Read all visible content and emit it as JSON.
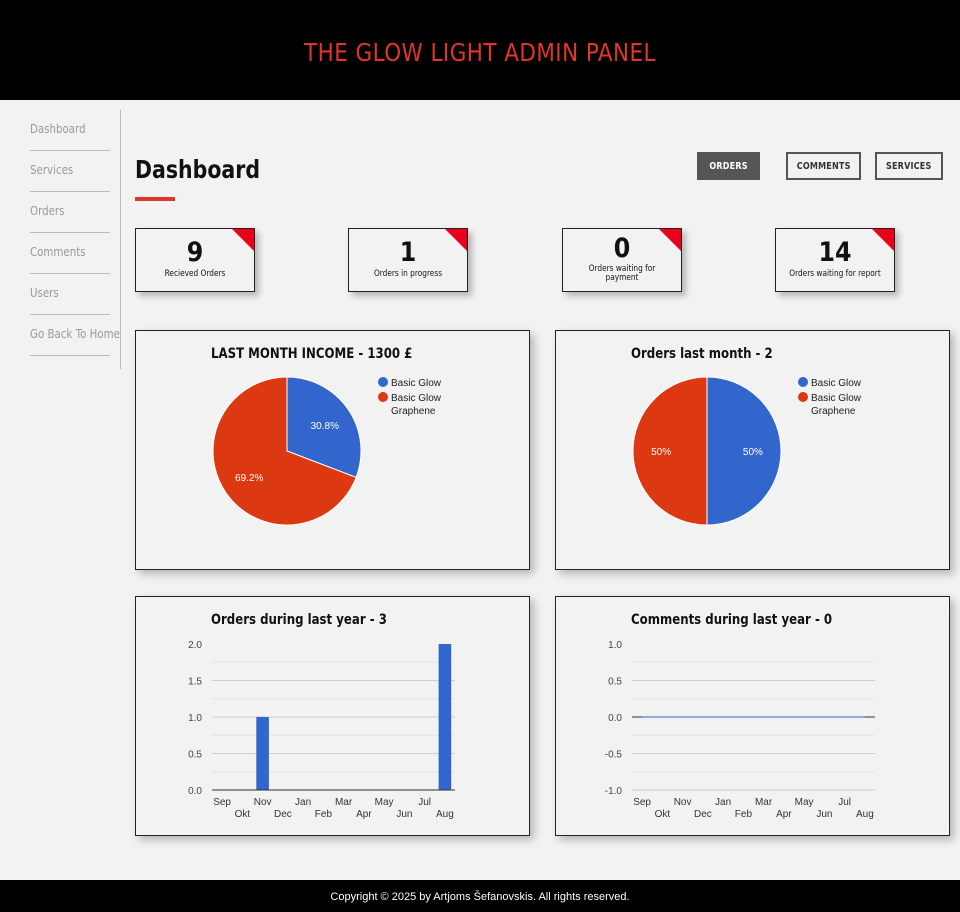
{
  "header": {
    "title": "THE GLOW LIGHT ADMIN PANEL"
  },
  "sidebar": {
    "items": [
      {
        "label": "Dashboard"
      },
      {
        "label": "Services"
      },
      {
        "label": "Orders"
      },
      {
        "label": "Comments"
      },
      {
        "label": "Users"
      },
      {
        "label": "Go Back To Home"
      }
    ]
  },
  "main": {
    "title": "Dashboard",
    "buttons": {
      "orders": "ORDERS",
      "comments": "COMMENTS",
      "services": "SERVICES"
    },
    "stats": [
      {
        "value": "9",
        "label": "Recieved Orders"
      },
      {
        "value": "1",
        "label": "Orders in progress"
      },
      {
        "value": "0",
        "label": "Orders waiting for payment"
      },
      {
        "value": "14",
        "label": "Orders waiting for report"
      }
    ]
  },
  "colors": {
    "accent": "#e0352b",
    "blue": "#3366cc",
    "red": "#dc3912",
    "corner": "#e8001c"
  },
  "chart_data": [
    {
      "type": "pie",
      "title": "LAST MONTH INCOME - 1300 £",
      "categories": [
        "Basic Glow",
        "Basic Glow Graphene"
      ],
      "values": [
        30.8,
        69.2
      ],
      "labels": [
        "30.8%",
        "69.2%"
      ],
      "colors": [
        "#3366cc",
        "#dc3912"
      ],
      "legend": "right"
    },
    {
      "type": "pie",
      "title": "Orders last month - 2",
      "categories": [
        "Basic Glow",
        "Basic Glow Graphene"
      ],
      "values": [
        50,
        50
      ],
      "labels": [
        "50%",
        "50%"
      ],
      "colors": [
        "#3366cc",
        "#dc3912"
      ],
      "legend": "right"
    },
    {
      "type": "bar",
      "title": "Orders during last year - 3",
      "categories": [
        "Sep",
        "Okt",
        "Nov",
        "Dec",
        "Jan",
        "Feb",
        "Mar",
        "Apr",
        "May",
        "Jun",
        "Jul",
        "Aug"
      ],
      "values": [
        0,
        0,
        1,
        0,
        0,
        0,
        0,
        0,
        0,
        0,
        0,
        2
      ],
      "yticks": [
        "0.0",
        "0.5",
        "1.0",
        "1.5",
        "2.0"
      ],
      "ylim": [
        0,
        2
      ],
      "grid": true,
      "color": "#3366cc"
    },
    {
      "type": "line",
      "title": "Comments during last year - 0",
      "categories": [
        "Sep",
        "Okt",
        "Nov",
        "Dec",
        "Jan",
        "Feb",
        "Mar",
        "Apr",
        "May",
        "Jun",
        "Jul",
        "Aug"
      ],
      "values": [
        0,
        0,
        0,
        0,
        0,
        0,
        0,
        0,
        0,
        0,
        0,
        0
      ],
      "yticks": [
        "-1.0",
        "-0.5",
        "0.0",
        "0.5",
        "1.0"
      ],
      "ylim": [
        -1,
        1
      ],
      "grid": true
    }
  ],
  "footer": {
    "copyright": "Copyright © 2025 by Artjoms Šefanovskis. All rights reserved."
  }
}
